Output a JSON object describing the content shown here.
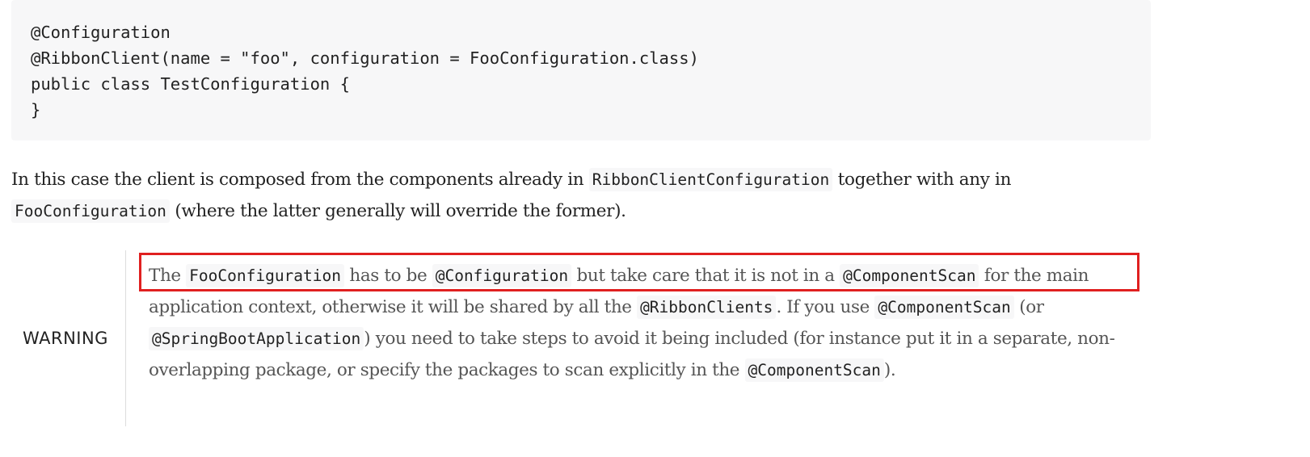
{
  "code_block": {
    "lines": [
      "@Configuration",
      "@RibbonClient(name = \"foo\", configuration = FooConfiguration.class)",
      "public class TestConfiguration {",
      "}"
    ]
  },
  "paragraph": {
    "text_1": "In this case the client is composed from the components already in ",
    "code_1": "RibbonClientConfiguration",
    "text_2": " together with any in ",
    "code_2": "FooConfiguration",
    "text_3": " (where the latter generally will override the former)."
  },
  "warning": {
    "label": "WARNING",
    "text_1": "The ",
    "code_1": "FooConfiguration",
    "text_2": " has to be ",
    "code_2": "@Configuration",
    "text_3": " but take care that it is not in a ",
    "code_3": "@ComponentScan",
    "text_4": " for the main application context, otherwise it will be shared by all the ",
    "code_4": "@RibbonClients",
    "text_5": ". If you use ",
    "code_5": "@ComponentScan",
    "text_6": " (or ",
    "code_6": "@SpringBootApplication",
    "text_7": ") you need to take steps to avoid it being included (for instance put it in a separate, non-overlapping package, or specify the packages to scan explicitly in the ",
    "code_7": "@ComponentScan",
    "text_8": ")."
  },
  "colors": {
    "highlight_border": "#e02020",
    "code_background": "#f7f7f8",
    "warning_text": "#555555"
  }
}
